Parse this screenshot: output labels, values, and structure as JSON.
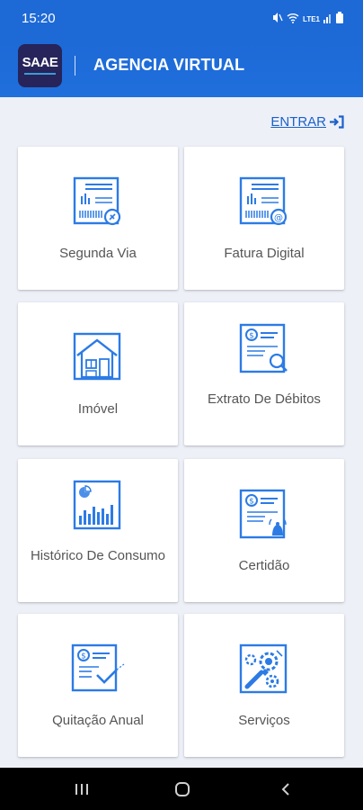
{
  "status_bar": {
    "time": "15:20",
    "network_label": "LTE1"
  },
  "header": {
    "logo_text": "SAAE",
    "title": "AGENCIA VIRTUAL"
  },
  "login": {
    "label": "ENTRAR",
    "icon": "login-arrow-icon"
  },
  "cards": [
    {
      "label": "Segunda Via",
      "icon": "invoice-copy-icon"
    },
    {
      "label": "Fatura Digital",
      "icon": "digital-invoice-icon"
    },
    {
      "label": "Imóvel",
      "icon": "house-icon"
    },
    {
      "label": "Extrato De Débitos",
      "icon": "debt-statement-icon"
    },
    {
      "label": "Histórico De Consumo",
      "icon": "consumption-chart-icon"
    },
    {
      "label": "Certidão",
      "icon": "certificate-icon"
    },
    {
      "label": "Quitação Anual",
      "icon": "annual-discharge-icon"
    },
    {
      "label": "Serviços",
      "icon": "services-gears-icon"
    }
  ],
  "colors": {
    "primary": "#1d69d6",
    "icon_blue": "#2c7be5",
    "background": "#eef0f8",
    "logo_bg": "#26245a"
  }
}
